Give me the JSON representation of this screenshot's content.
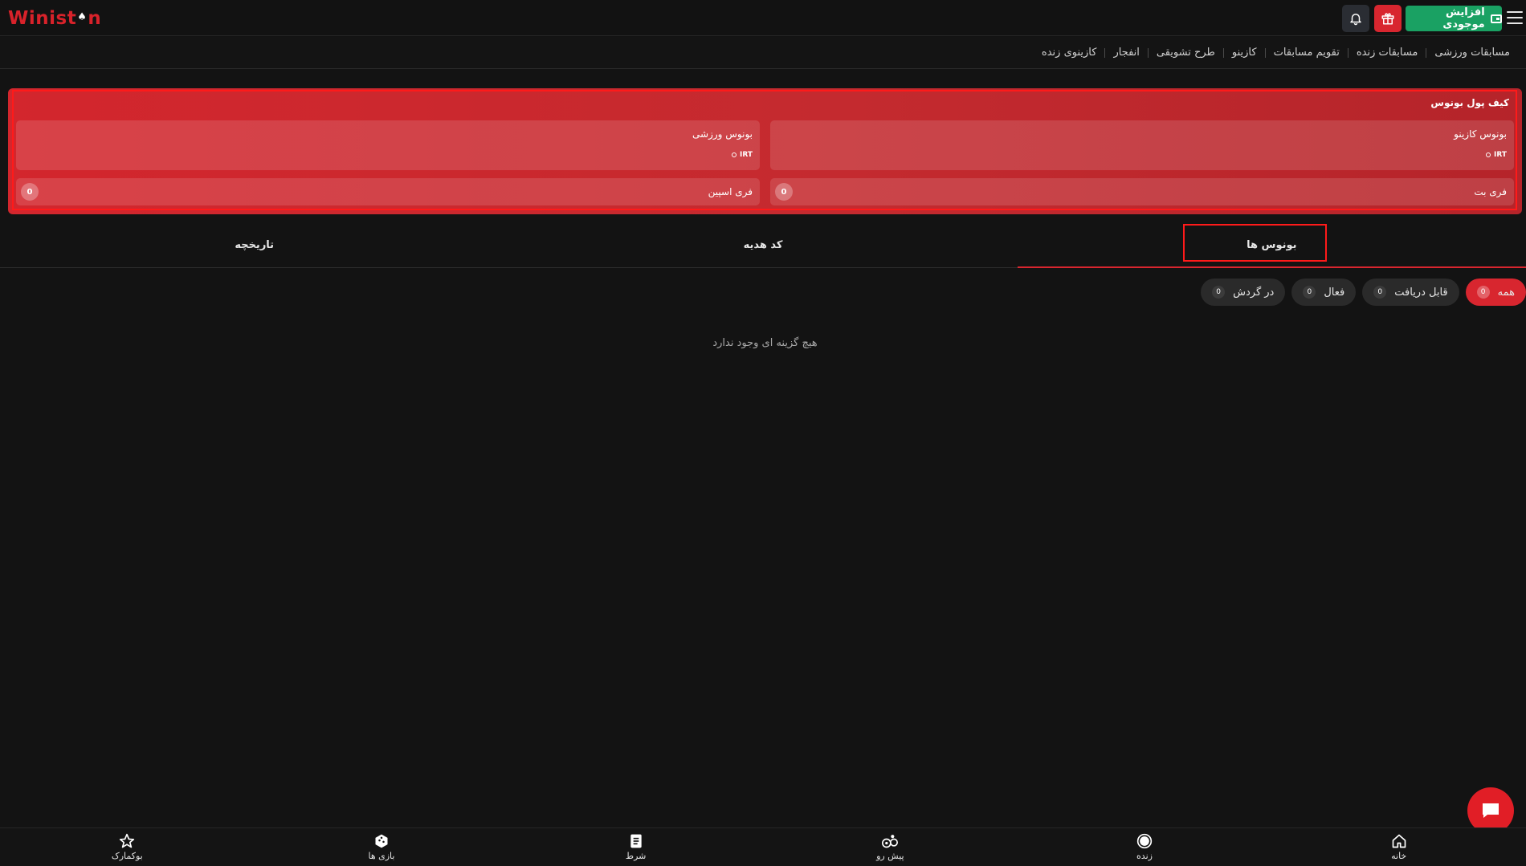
{
  "header": {
    "logo_text_a": "Winist",
    "logo_text_b": "n",
    "deposit_label": "افزایش موجودی",
    "icons": [
      "hamburger-icon",
      "wallet-icon",
      "gift-icon",
      "bell-icon"
    ]
  },
  "nav": {
    "items": [
      {
        "label": "مسابقات ورزشی"
      },
      {
        "label": "مسابقات زنده"
      },
      {
        "label": "تقویم مسابقات"
      },
      {
        "label": "کازینو"
      },
      {
        "label": "طرح تشویقی"
      },
      {
        "label": "انفجار"
      },
      {
        "label": "کازینوی زنده"
      }
    ]
  },
  "bonus_wallet": {
    "title": "کیف پول بونوس",
    "casino_bonus": {
      "label": "بونوس کازینو",
      "amount": "IRT"
    },
    "sports_bonus": {
      "label": "بونوس ورزشی",
      "amount": "IRT"
    },
    "free_bet": {
      "label": "فری بت",
      "count": "0"
    },
    "free_spin": {
      "label": "فری اسپین",
      "count": "0"
    }
  },
  "tabs": [
    {
      "label": "بونوس ها",
      "active": true
    },
    {
      "label": "کد هدیه",
      "active": false
    },
    {
      "label": "تاریخچه",
      "active": false
    }
  ],
  "filters": [
    {
      "label": "همه",
      "count": "0",
      "active": true
    },
    {
      "label": "قابل دریافت",
      "count": "0",
      "active": false
    },
    {
      "label": "فعال",
      "count": "0",
      "active": false
    },
    {
      "label": "در گردش",
      "count": "0",
      "active": false
    }
  ],
  "empty_message": "هیچ گزینه ای وجود ندارد",
  "bottom_nav": [
    {
      "label": "خانه",
      "icon": "home-icon"
    },
    {
      "label": "زنده",
      "icon": "live-icon"
    },
    {
      "label": "پیش رو",
      "icon": "upcoming-icon"
    },
    {
      "label": "شرط",
      "icon": "betslip-icon"
    },
    {
      "label": "بازی ها",
      "icon": "games-icon"
    },
    {
      "label": "بوکمارک",
      "icon": "star-icon"
    }
  ],
  "colors": {
    "accent_red": "#d8262f",
    "deposit_green": "#1aa163",
    "background": "#131313"
  }
}
